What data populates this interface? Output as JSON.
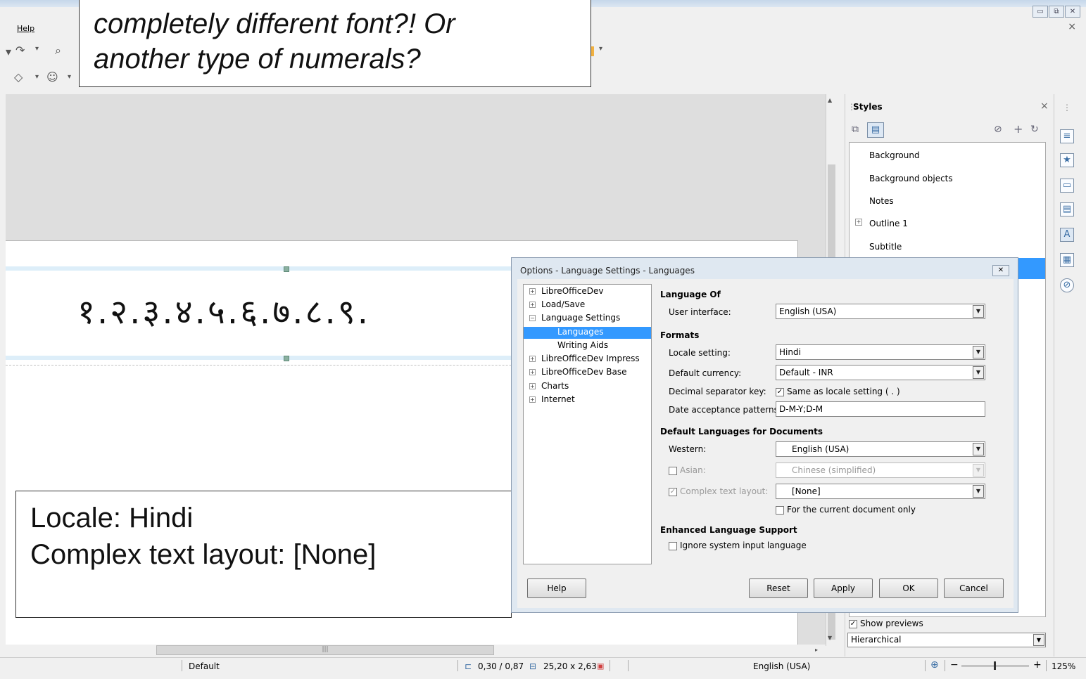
{
  "window": {
    "btn_min": "▭",
    "btn_restore": "⧉",
    "btn_close": "✕"
  },
  "menubar": {
    "help": "Help",
    "close_doc": "×"
  },
  "slide": {
    "numerals": "१.२.३.४.५.६.७.८.९."
  },
  "callouts": {
    "top_line1": "completely different font?! Or",
    "top_line2": "another type of numerals?",
    "bottom_line1": "Locale: Hindi",
    "bottom_line2": "Complex text layout: [None]"
  },
  "styles_panel": {
    "title": "Styles",
    "close": "×",
    "items": [
      {
        "label": "Background"
      },
      {
        "label": "Background objects"
      },
      {
        "label": "Notes"
      },
      {
        "label": "Outline 1",
        "expandable": true
      },
      {
        "label": "Subtitle"
      }
    ],
    "show_previews": "Show previews",
    "show_previews_checked": true,
    "filter_value": "Hierarchical"
  },
  "dialog": {
    "title": "Options - Language Settings - Languages",
    "tree": [
      {
        "label": "LibreOfficeDev",
        "exp": "+"
      },
      {
        "label": "Load/Save",
        "exp": "+"
      },
      {
        "label": "Language Settings",
        "exp": "−"
      },
      {
        "label": "Languages",
        "selected": true
      },
      {
        "label": "Writing Aids"
      },
      {
        "label": "LibreOfficeDev Impress",
        "exp": "+"
      },
      {
        "label": "LibreOfficeDev Base",
        "exp": "+"
      },
      {
        "label": "Charts",
        "exp": "+"
      },
      {
        "label": "Internet",
        "exp": "+"
      }
    ],
    "language_of": {
      "heading": "Language Of",
      "ui_label": "User interface:",
      "ui_value": "English (USA)"
    },
    "formats": {
      "heading": "Formats",
      "locale_label": "Locale setting:",
      "locale_value": "Hindi",
      "currency_label": "Default currency:",
      "currency_value": "Default - INR",
      "decimal_label": "Decimal separator key:",
      "decimal_check": "Same as locale setting ( . )",
      "date_label": "Date acceptance patterns:",
      "date_value": "D-M-Y;D-M"
    },
    "default_langs": {
      "heading": "Default Languages for Documents",
      "western_label": "Western:",
      "western_value": "English (USA)",
      "asian_label": "Asian:",
      "asian_value": "Chinese (simplified)",
      "ctl_label": "Complex text layout:",
      "ctl_value": "[None]",
      "current_doc": "For the current document only"
    },
    "enhanced": {
      "heading": "Enhanced Language Support",
      "ignore_input": "Ignore system input language"
    },
    "buttons": {
      "help": "Help",
      "reset": "Reset",
      "apply": "Apply",
      "ok": "OK",
      "cancel": "Cancel"
    }
  },
  "statusbar": {
    "layout": "Default",
    "position": "0,30 / 0,87",
    "size": "25,20 x 2,63",
    "language": "English (USA)",
    "zoom": "125%"
  },
  "colors": {
    "selection": "#3399ff",
    "dialog_frame": "#dfe8f1"
  }
}
